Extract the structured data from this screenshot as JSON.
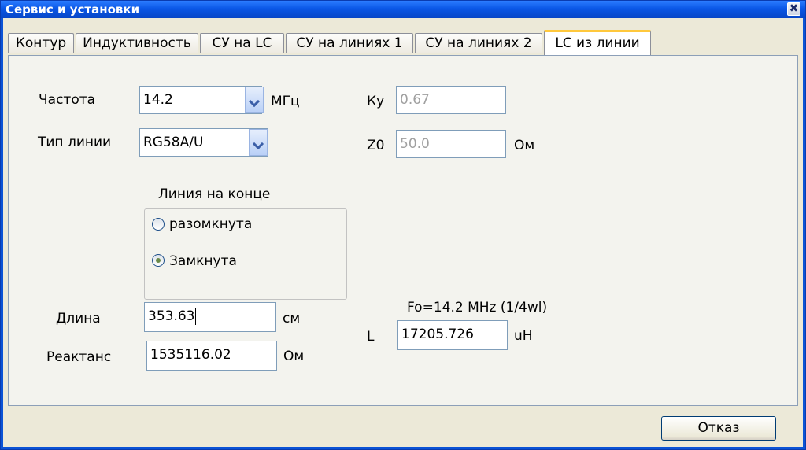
{
  "window": {
    "title": "Сервис и установки",
    "close_symbol": "✖"
  },
  "tabs": [
    {
      "label": "Контур"
    },
    {
      "label": "Индуктивность"
    },
    {
      "label": "СУ на LC"
    },
    {
      "label": "СУ на линиях 1"
    },
    {
      "label": "СУ на линиях 2"
    },
    {
      "label": "LC из линии"
    }
  ],
  "active_tab": "LC из линии",
  "form": {
    "frequency_label": "Частота",
    "frequency_value": "14.2",
    "frequency_unit": "МГц",
    "line_type_label": "Тип линии",
    "line_type_value": "RG58A/U",
    "ky_label": "Ку",
    "ky_value": "0.67",
    "z0_label": "Z0",
    "z0_value": "50.0",
    "z0_unit": "Ом",
    "line_end_group": "Линия на конце",
    "radio_open": "разомкнута",
    "radio_closed": "Замкнута",
    "radio_selected": "Замкнута",
    "length_label": "Длина",
    "length_value": "353.63",
    "length_unit": "см",
    "reactance_label": "Реактанс",
    "reactance_value": "1535116.02",
    "reactance_unit": "Ом",
    "fo_text": "Fo=14.2 MHz (1/4wl)",
    "l_label": "L",
    "l_value": "17205.726",
    "l_unit": "uH"
  },
  "buttons": {
    "cancel": "Отказ"
  }
}
